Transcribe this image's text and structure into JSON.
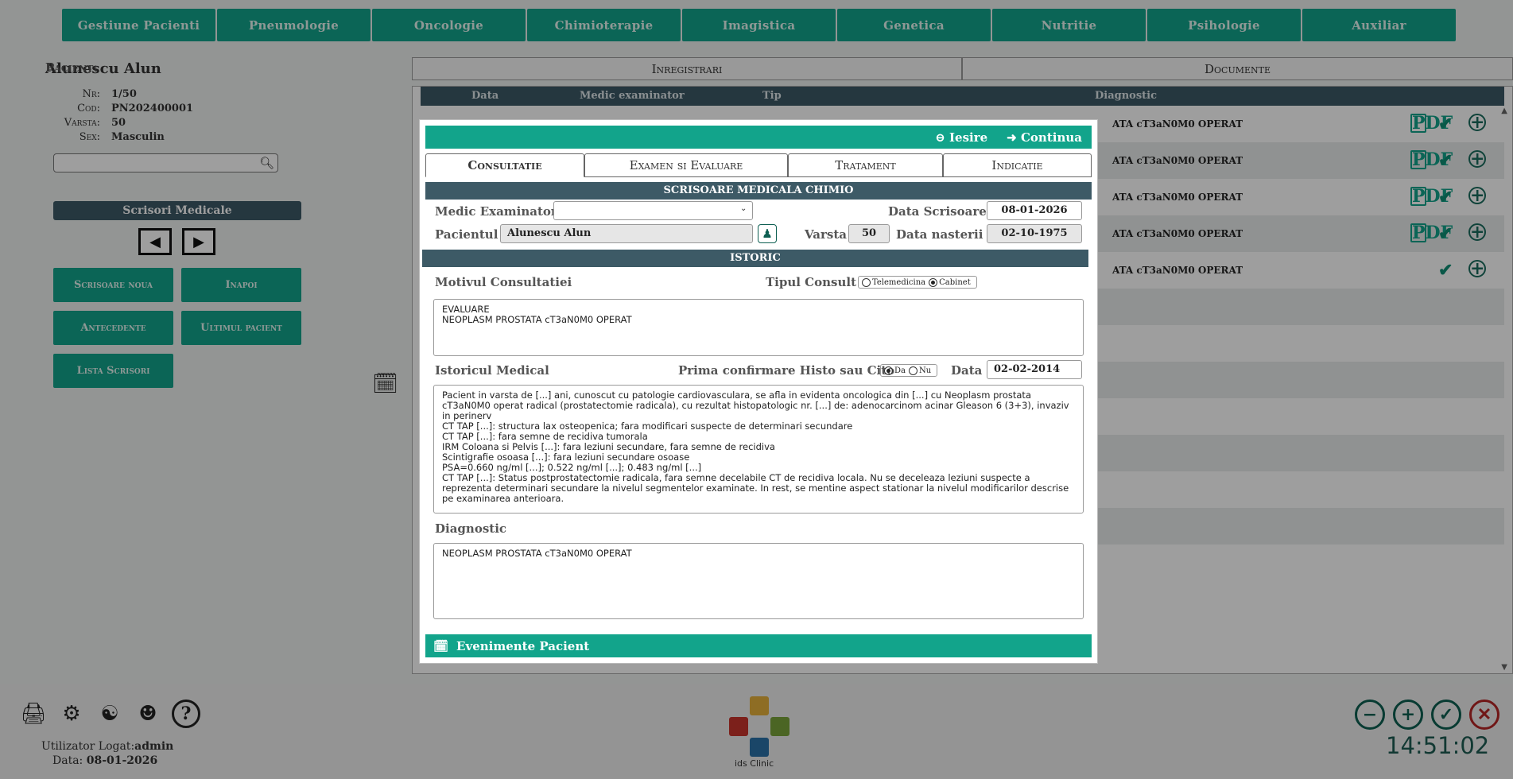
{
  "nav": [
    "Gestiune Pacienti",
    "Pneumologie",
    "Oncologie",
    "Chimioterapie",
    "Imagistica",
    "Genetica",
    "Nutritie",
    "Psihologie",
    "Auxiliar"
  ],
  "patient": {
    "label": "Pacient:",
    "name": "Alunescu Alun",
    "nr_k": "Nr:",
    "nr": "1/50",
    "cod_k": "Cod:",
    "cod": "PN202400001",
    "varsta_k": "Varsta:",
    "varsta": "50",
    "sex_k": "Sex:",
    "sex": "Masculin"
  },
  "search": {
    "placeholder": ""
  },
  "scrisori": {
    "title": "Scrisori Medicale",
    "btn_noua": "Scrisoare noua",
    "btn_inapoi": "Inapoi",
    "btn_antecedente": "Antecedente",
    "btn_ultimul": "Ultimul pacient",
    "btn_lista": "Lista Scrisori"
  },
  "right": {
    "tab_inregistrari": "Inregistrari",
    "tab_documente": "Documente",
    "cols": {
      "data": "Data",
      "medic": "Medic examinator",
      "tip": "Tip",
      "diagnostic": "Diagnostic"
    },
    "rows": [
      {
        "diagnostic": "ATA cT3aN0M0 OPERAT",
        "pdf": true
      },
      {
        "diagnostic": "ATA cT3aN0M0 OPERAT",
        "pdf": true
      },
      {
        "diagnostic": "ATA cT3aN0M0 OPERAT",
        "pdf": true
      },
      {
        "diagnostic": "ATA cT3aN0M0 OPERAT",
        "pdf": true
      },
      {
        "diagnostic": "ATA cT3aN0M0 OPERAT",
        "pdf": false
      }
    ]
  },
  "modal": {
    "btn_iesire": "Iesire",
    "btn_continua": "Continua",
    "tabs": [
      "Consultatie",
      "Examen si Evaluare",
      "Tratament",
      "Indicatie"
    ],
    "section_title": "SCRISOARE MEDICALA CHIMIO",
    "medic_label": "Medic Examinator",
    "medic_value": "",
    "data_scrisoare_label": "Data Scrisoare",
    "data_scrisoare": "08-01-2026",
    "pacient_label": "Pacientul",
    "pacient_value": "Alunescu Alun",
    "varsta_label": "Varsta",
    "varsta_value": "50",
    "data_nasterii_label": "Data nasterii",
    "data_nasterii": "02-10-1975",
    "istoric_title": "ISTORIC",
    "motiv_label": "Motivul Consultatiei",
    "tip_consult_label": "Tipul Consult",
    "tip_consult_options": [
      "Telemedicina",
      "Cabinet"
    ],
    "tip_consult_selected": "Cabinet",
    "motiv_text": "EVALUARE\nNEOPLASM PROSTATA cT3aN0M0 OPERAT",
    "istoric_label": "Istoricul Medical",
    "histo_label": "Prima confirmare Histo sau Cito",
    "histo_options": [
      "Da",
      "Nu"
    ],
    "histo_selected": "Da",
    "data_label": "Data",
    "data_value": "02-02-2014",
    "istoric_text": "Pacient in varsta de [...] ani, cunoscut cu patologie cardiovasculara, se afla in evidenta oncologica din [...] cu Neoplasm prostata cT3aN0M0 operat radical (prostatectomie radicala), cu rezultat histopatologic nr. [...] de: adenocarcinom acinar Gleason 6 (3+3), invaziv in perinerv\nCT TAP [...]: structura lax osteopenica; fara modificari suspecte de determinari secundare\nCT TAP [...]: fara semne de recidiva tumorala\nIRM Coloana si Pelvis [...]: fara leziuni secundare, fara semne de recidiva\nScintigrafie osoasa [...]: fara leziuni secundare osoase\nPSA=0.660 ng/ml [...]; 0.522 ng/ml [...]; 0.483 ng/ml [...]\nCT TAP [...]: Status postprostatectomie radicala, fara semne decelabile CT de recidiva locala. Nu se deceleaza leziuni suspecte a reprezenta determinari secundare la nivelul segmentelor examinate. In rest, se mentine aspect stationar la nivelul modificarilor descrise pe examinarea anterioara.",
    "diagnostic_label": "Diagnostic",
    "diagnostic_text": "NEOPLASM PROSTATA cT3aN0M0 OPERAT",
    "footer": "Evenimente Pacient"
  },
  "bottom": {
    "user_label": "Utilizator Logat:",
    "user": "admin",
    "date_label": "Data:",
    "date": "08-01-2026",
    "logo_caption": "ids Clinic",
    "clock": "14:51:02"
  },
  "icons": {
    "bottom_left": [
      "server-icon",
      "gear-icon",
      "org-chart-icon",
      "support-agent-icon",
      "help-icon"
    ],
    "bottom_right": [
      "zoom-out-icon",
      "zoom-in-icon",
      "check-circle-icon",
      "close-circle-icon"
    ]
  },
  "colors": {
    "accent": "#12a48b",
    "header_dark": "#3d5a66",
    "clock": "#1d5c53"
  }
}
